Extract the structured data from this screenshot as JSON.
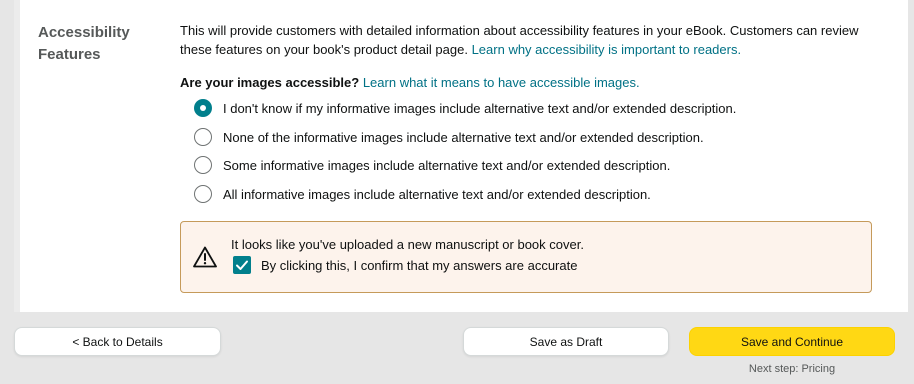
{
  "section": {
    "title_line1": "Accessibility",
    "title_line2": "Features",
    "description": "This will provide customers with detailed information about accessibility features in your eBook. Customers can review these features on your book's product detail page.",
    "description_link": "Learn why accessibility is important to readers."
  },
  "images_question": {
    "label": "Are your images accessible?",
    "link": "Learn what it means to have accessible images.",
    "selected_index": 0,
    "options": [
      "I don't know if my informative images include alternative text and/or extended description.",
      "None of the informative images include alternative text and/or extended description.",
      "Some informative images include alternative text and/or extended description.",
      "All informative images include alternative text and/or extended description."
    ]
  },
  "alert": {
    "icon": "warning-icon",
    "message": "It looks like you've uploaded a new manuscript or book cover.",
    "confirm_label": "By clicking this, I confirm that my answers are accurate",
    "confirm_checked": true
  },
  "footer": {
    "back_label": "< Back to Details",
    "draft_label": "Save as Draft",
    "continue_label": "Save and Continue",
    "next_step": "Next step: Pricing"
  },
  "colors": {
    "accent_teal": "#017f8c",
    "link": "#007185",
    "primary_button": "#ffd814",
    "alert_background": "#fdf3ec",
    "alert_border": "#c59a5a"
  }
}
